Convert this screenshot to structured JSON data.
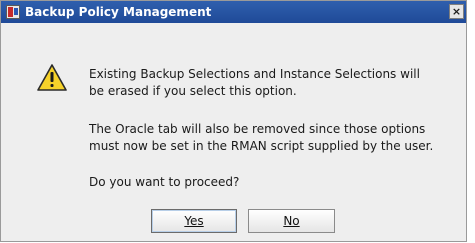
{
  "window": {
    "title": "Backup Policy Management",
    "close_glyph": "×"
  },
  "dialog": {
    "icon": "warning-icon",
    "lines": [
      "Existing Backup Selections and Instance Selections will",
      "be erased if you select this option.",
      "The Oracle tab will also be removed since those options",
      "must now be set in the RMAN script supplied by the user.",
      "Do you want to proceed?"
    ]
  },
  "buttons": {
    "yes": "Yes",
    "no": "No"
  },
  "colors": {
    "title_bar": "#2f5fae",
    "warning_fill": "#f6d22a"
  }
}
